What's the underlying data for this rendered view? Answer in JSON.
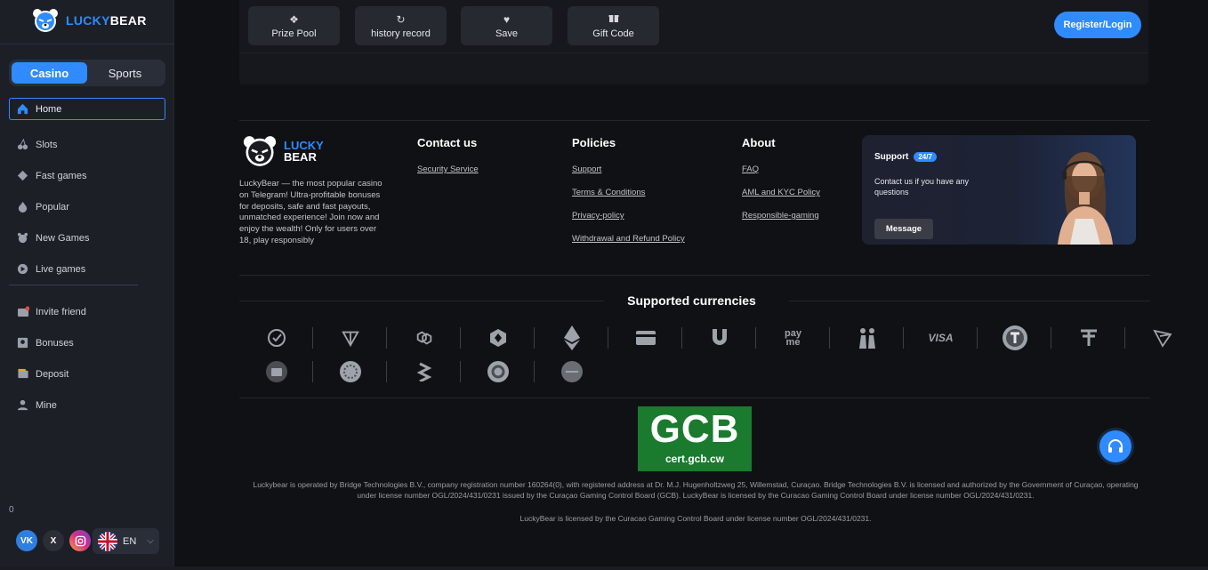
{
  "brand": {
    "name_a": "LUCKY",
    "name_b": "BEAR",
    "footer_a": "LUCKY",
    "footer_b": "BEAR"
  },
  "sidebar": {
    "segment": {
      "casino": "Casino",
      "sports": "Sports"
    },
    "items": [
      {
        "label": "Home",
        "icon": "home-icon"
      },
      {
        "label": "Slots",
        "icon": "cherries-icon"
      },
      {
        "label": "Fast games",
        "icon": "diamond-icon"
      },
      {
        "label": "Popular",
        "icon": "fire-icon"
      },
      {
        "label": "New Games",
        "icon": "new-games-icon"
      },
      {
        "label": "Live games",
        "icon": "live-icon"
      }
    ],
    "items2": [
      {
        "label": "Invite friend",
        "icon": "invite-icon"
      },
      {
        "label": "Bonuses",
        "icon": "bonus-icon"
      },
      {
        "label": "Deposit",
        "icon": "wallet-icon"
      },
      {
        "label": "Mine",
        "icon": "user-icon"
      }
    ],
    "counter": "0",
    "language": "EN"
  },
  "topbar": {
    "buttons": [
      "Prize Pool",
      "history record",
      "Save",
      "Gift Code"
    ],
    "register": "Register/Login"
  },
  "footer": {
    "description": "LuckyBear — the most popular casino on Telegram! Ultra-profitable bonuses for deposits, safe and fast payouts, unmatched experience! Join now and enjoy the wealth! Only for users over 18, play responsibly",
    "contact": {
      "title": "Contact us",
      "links": [
        "Security Service"
      ]
    },
    "policies": {
      "title": "Policies",
      "links": [
        "Support",
        "Terms & Conditions",
        "Privacy-policy",
        "Withdrawal and Refund Policy"
      ]
    },
    "about": {
      "title": "About",
      "links": [
        "FAQ",
        "AML and KYC Policy",
        "Responsible-gaming"
      ]
    },
    "support": {
      "title": "Support",
      "badge": "24/7",
      "sub": "Contact us if you have any questions",
      "button": "Message"
    },
    "currencies_title": "Supported currencies",
    "currencies_row1": [
      "check",
      "ton",
      "polygon",
      "bnb",
      "eth",
      "card",
      "u",
      "payme",
      "pair",
      "VISA",
      "T",
      "tether",
      "tron"
    ],
    "currencies_row2": [
      "wallet",
      "flower",
      "bt",
      "ring",
      "uzcard"
    ],
    "gcb": {
      "big": "GCB",
      "small": "cert.gcb.cw"
    },
    "legal": "Luckybear is operated by Bridge Technologies B.V., company registration number 160264(0), with registered address at Dr. M.J. Hugenholtzweg 25, Willemstad, Curaçao. Bridge Technologies B.V. is licensed and authorized by the Government of Curaçao, operating under license number OGL/2024/431/0231 issued by the Curaçao Gaming Control Board (GCB). LuckyBear is licensed by the Curacao Gaming Control Board under license number OGL/2024/431/0231.",
    "legal2": "LuckyBear is licensed by the Curacao Gaming Control Board under license number OGL/2024/431/0231."
  },
  "colors": {
    "accent": "#2f8bff",
    "bg": "#101114",
    "sidebar": "#1c1f26"
  }
}
